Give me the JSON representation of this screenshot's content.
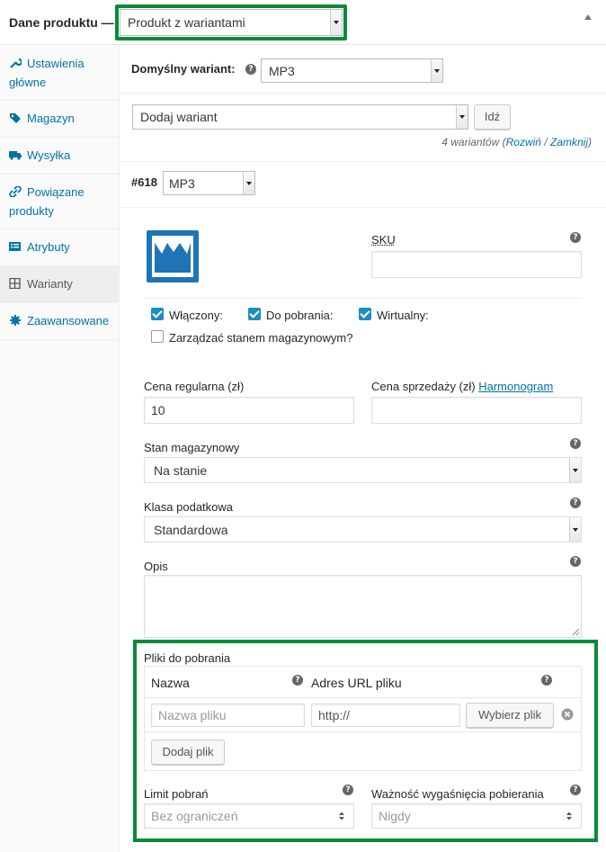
{
  "header": {
    "title": "Dane produktu —",
    "product_type": "Produkt z wariantami"
  },
  "sidebar": {
    "items": [
      {
        "label": "Ustawienia główne",
        "icon": "wrench-icon"
      },
      {
        "label": "Magazyn",
        "icon": "tag-icon"
      },
      {
        "label": "Wysyłka",
        "icon": "truck-icon"
      },
      {
        "label": "Powiązane produkty",
        "icon": "link-icon"
      },
      {
        "label": "Atrybuty",
        "icon": "list-icon"
      },
      {
        "label": "Warianty",
        "icon": "grid-icon"
      },
      {
        "label": "Zaawansowane",
        "icon": "gear-icon"
      }
    ]
  },
  "default_variant": {
    "label": "Domyślny wariant:",
    "value": "MP3"
  },
  "add_variant": {
    "select_value": "Dodaj wariant",
    "go_label": "Idź",
    "count_text": "4 wariantów (",
    "expand_label": "Rozwiń",
    "separator": " / ",
    "collapse_label": "Zamknij",
    "close_paren": ")"
  },
  "variation": {
    "id_label": "#618",
    "attribute_value": "MP3",
    "sku_label": "SKU",
    "sku_value": "",
    "checkboxes": {
      "enabled": {
        "label": "Włączony:",
        "checked": true
      },
      "downloadable": {
        "label": "Do pobrania:",
        "checked": true
      },
      "virtual": {
        "label": "Wirtualny:",
        "checked": true
      },
      "manage_stock": {
        "label": "Zarządzać stanem magazynowym?",
        "checked": false
      }
    },
    "regular_price_label": "Cena regularna (zł)",
    "regular_price_value": "10",
    "sale_price_label": "Cena sprzedaży (zł)",
    "schedule_link": "Harmonogram",
    "sale_price_value": "",
    "stock_status_label": "Stan magazynowy",
    "stock_status_value": "Na stanie",
    "tax_class_label": "Klasa podatkowa",
    "tax_class_value": "Standardowa",
    "description_label": "Opis",
    "description_value": ""
  },
  "downloads": {
    "section_label": "Pliki do pobrania",
    "col_name": "Nazwa",
    "col_url": "Adres URL pliku",
    "file_name_placeholder": "Nazwa pliku",
    "file_url_value": "http://",
    "choose_file_label": "Wybierz plik",
    "add_file_label": "Dodaj plik",
    "limit_label": "Limit pobrań",
    "limit_placeholder": "Bez ograniczeń",
    "expiry_label": "Ważność wygaśnięcia pobierania",
    "expiry_placeholder": "Nigdy"
  },
  "colors": {
    "highlight": "#0a8a3a",
    "link": "#0073aa",
    "checkbox": "#1e8cbe"
  }
}
